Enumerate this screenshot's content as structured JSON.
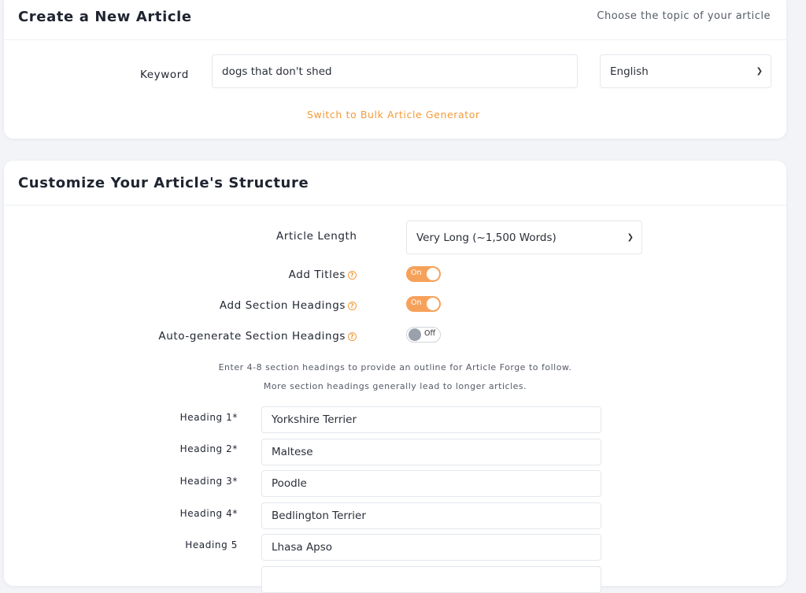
{
  "create": {
    "title": "Create a New Article",
    "subtitle": "Choose the topic of your article",
    "keyword_label": "Keyword",
    "keyword_value": "dogs that don't shed",
    "language_value": "English",
    "bulk_link": "Switch to Bulk Article Generator"
  },
  "customize": {
    "title": "Customize Your Article's Structure",
    "length_label": "Article Length",
    "length_value": "Very Long (~1,500 Words)",
    "add_titles_label": "Add Titles",
    "add_titles_state": "On",
    "add_section_headings_label": "Add Section Headings",
    "add_section_headings_state": "On",
    "auto_generate_label": "Auto-generate Section Headings",
    "auto_generate_state": "Off",
    "hint_line1": "Enter 4-8 section headings to provide an outline for Article Forge to follow.",
    "hint_line2": "More section headings generally lead to longer articles.",
    "headings": [
      {
        "label": "Heading 1*",
        "value": "Yorkshire Terrier"
      },
      {
        "label": "Heading 2*",
        "value": "Maltese"
      },
      {
        "label": "Heading 3*",
        "value": "Poodle"
      },
      {
        "label": "Heading 4*",
        "value": "Bedlington Terrier"
      },
      {
        "label": "Heading 5",
        "value": "Lhasa Apso"
      }
    ]
  },
  "colors": {
    "accent": "#f39a3c",
    "toggle_on": "#f6a15a",
    "background": "#f2f4f7"
  },
  "icons": {
    "help": "question-circle-icon",
    "dropdown": "chevron-down-icon"
  }
}
